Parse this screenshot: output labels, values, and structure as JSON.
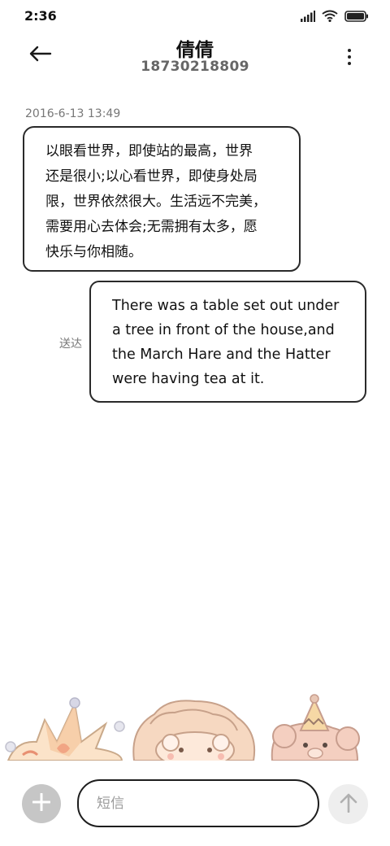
{
  "status_bar": {
    "time": "2:36",
    "icons": [
      "signal-icon",
      "wifi-icon",
      "battery-icon"
    ]
  },
  "header": {
    "back_icon": "arrow-left-icon",
    "contact_name": "倩倩",
    "contact_phone": "18730218809",
    "more_icon": "more-vertical-icon"
  },
  "conversation": {
    "timestamp": "2016-6-13 13:49",
    "incoming": {
      "lines": [
        "以眼看世界，即使站的最高，世界",
        "还是很小;以心看世界，即使身处局",
        "限，世界依然很大。生活远不完美，",
        "需要用心去体会;无需拥有太多，愿",
        "快乐与你相随。"
      ]
    },
    "outgoing": {
      "lines": [
        "There was a table set out under",
        "a tree in front of the house,and",
        "the March Hare and the Hatter",
        "were having tea at it."
      ],
      "status": "送达"
    }
  },
  "composer": {
    "add_icon": "plus-icon",
    "placeholder": "短信",
    "send_icon": "arrow-up-icon"
  },
  "colors": {
    "bubble_border": "#2a2a2a",
    "add_button_bg": "#c6c6c6",
    "send_button_bg": "#eeeeee",
    "secondary_text": "#777777"
  }
}
